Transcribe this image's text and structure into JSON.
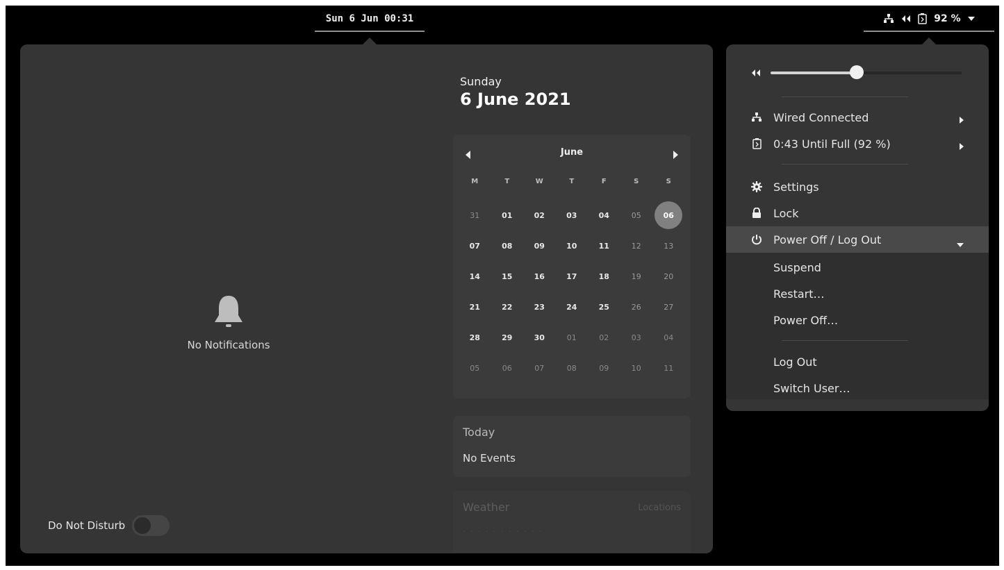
{
  "topbar": {
    "clock": "Sun 6 Jun  00:31",
    "battery_percent": "92 %",
    "icons": [
      "network-wired-icon",
      "volume-icon",
      "battery-icon",
      "dropdown-arrow-icon"
    ]
  },
  "notifications": {
    "empty_text": "No Notifications",
    "dnd_label": "Do Not Disturb",
    "dnd_enabled": false
  },
  "date_header": {
    "weekday": "Sunday",
    "full_date": "6 June 2021"
  },
  "calendar": {
    "month": "June",
    "weekdays": [
      "M",
      "T",
      "W",
      "T",
      "F",
      "S",
      "S"
    ],
    "today": "06",
    "weeks": [
      [
        {
          "t": "31",
          "c": "other"
        },
        {
          "t": "01"
        },
        {
          "t": "02"
        },
        {
          "t": "03"
        },
        {
          "t": "04"
        },
        {
          "t": "05",
          "c": "weekend"
        },
        {
          "t": "06",
          "c": "today"
        }
      ],
      [
        {
          "t": "07"
        },
        {
          "t": "08"
        },
        {
          "t": "09"
        },
        {
          "t": "10"
        },
        {
          "t": "11"
        },
        {
          "t": "12",
          "c": "weekend"
        },
        {
          "t": "13",
          "c": "weekend"
        }
      ],
      [
        {
          "t": "14"
        },
        {
          "t": "15"
        },
        {
          "t": "16"
        },
        {
          "t": "17"
        },
        {
          "t": "18"
        },
        {
          "t": "19",
          "c": "weekend"
        },
        {
          "t": "20",
          "c": "weekend"
        }
      ],
      [
        {
          "t": "21"
        },
        {
          "t": "22"
        },
        {
          "t": "23"
        },
        {
          "t": "24"
        },
        {
          "t": "25"
        },
        {
          "t": "26",
          "c": "weekend"
        },
        {
          "t": "27",
          "c": "weekend"
        }
      ],
      [
        {
          "t": "28"
        },
        {
          "t": "29"
        },
        {
          "t": "30"
        },
        {
          "t": "01",
          "c": "other"
        },
        {
          "t": "02",
          "c": "other"
        },
        {
          "t": "03",
          "c": "other"
        },
        {
          "t": "04",
          "c": "other"
        }
      ],
      [
        {
          "t": "05",
          "c": "other"
        },
        {
          "t": "06",
          "c": "other"
        },
        {
          "t": "07",
          "c": "other"
        },
        {
          "t": "08",
          "c": "other"
        },
        {
          "t": "09",
          "c": "other"
        },
        {
          "t": "10",
          "c": "other"
        },
        {
          "t": "11",
          "c": "other"
        }
      ]
    ]
  },
  "events": {
    "title": "Today",
    "status": "No Events"
  },
  "weather": {
    "title": "Weather",
    "right_text": "Locations",
    "hours_text": "· · · · · · · · · · ·"
  },
  "system_menu": {
    "volume_level": 0.45,
    "network_label": "Wired Connected",
    "battery_label": "0:43 Until Full (92 %)",
    "settings_label": "Settings",
    "lock_label": "Lock",
    "power_label": "Power Off / Log Out",
    "power_submenu": [
      "Suspend",
      "Restart…",
      "Power Off…",
      "Log Out",
      "Switch User…"
    ]
  },
  "colors": {
    "panel_bg": "#000000",
    "popover_bg": "#353535",
    "card_bg": "#3b3b3b",
    "accent_today": "#808080"
  }
}
